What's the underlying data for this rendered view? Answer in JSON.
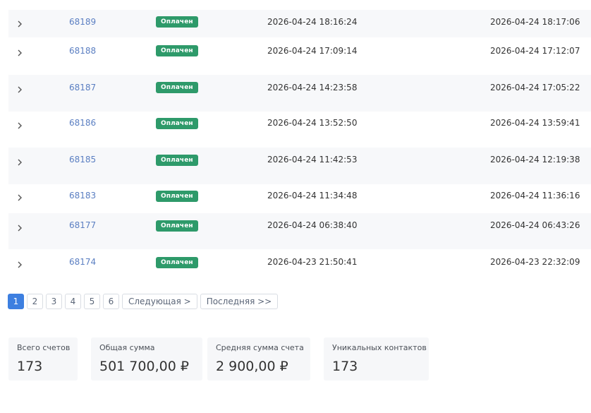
{
  "invoices": [
    {
      "id": "68189",
      "status": "Оплачен",
      "created": "2026-04-24 18:16:24",
      "paid": "2026-04-24 18:17:06"
    },
    {
      "id": "68188",
      "status": "Оплачен",
      "created": "2026-04-24 17:09:14",
      "paid": "2026-04-24 17:12:07"
    },
    {
      "id": "68187",
      "status": "Оплачен",
      "created": "2026-04-24 14:23:58",
      "paid": "2026-04-24 17:05:22"
    },
    {
      "id": "68186",
      "status": "Оплачен",
      "created": "2026-04-24 13:52:50",
      "paid": "2026-04-24 13:59:41"
    },
    {
      "id": "68185",
      "status": "Оплачен",
      "created": "2026-04-24 11:42:53",
      "paid": "2026-04-24 12:19:38"
    },
    {
      "id": "68183",
      "status": "Оплачен",
      "created": "2026-04-24 11:34:48",
      "paid": "2026-04-24 11:36:16"
    },
    {
      "id": "68177",
      "status": "Оплачен",
      "created": "2026-04-24 06:38:40",
      "paid": "2026-04-24 06:43:26"
    },
    {
      "id": "68174",
      "status": "Оплачен",
      "created": "2026-04-23 21:50:41",
      "paid": "2026-04-23 22:32:09"
    }
  ],
  "pagination": {
    "pages": [
      "1",
      "2",
      "3",
      "4",
      "5",
      "6"
    ],
    "current": "1",
    "next_label": "Следующая >",
    "last_label": "Последняя >>"
  },
  "stats": {
    "total_invoices_label": "Всего счетов",
    "total_invoices_value": "173",
    "total_sum_label": "Общая сумма",
    "total_sum_value": "501 700,00 ₽",
    "avg_sum_label": "Средняя сумма счета",
    "avg_sum_value": "2 900,00 ₽",
    "unique_contacts_label": "Уникальных контактов",
    "unique_contacts_value": "173"
  },
  "colors": {
    "badge_paid": "#2e9a6a",
    "link": "#5b7fc2",
    "page_active": "#3d7fe0",
    "row_stripe": "#f7f8fa"
  },
  "icons": {
    "expand": "chevron-right-icon"
  }
}
